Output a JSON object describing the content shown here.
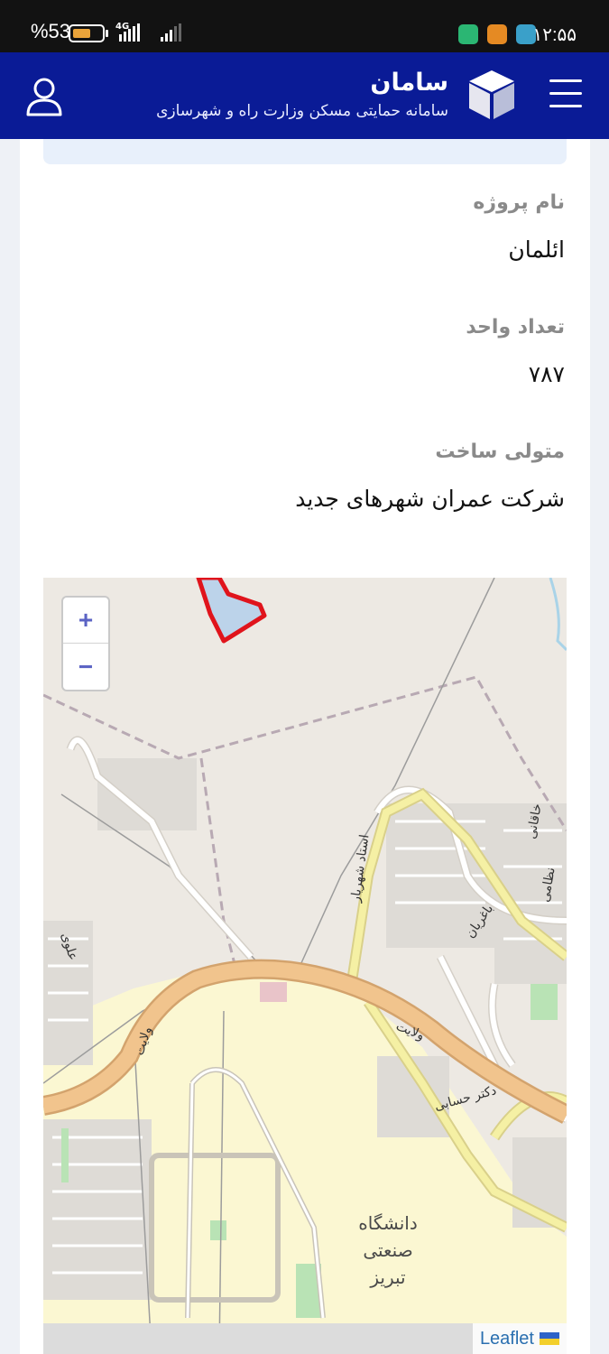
{
  "status_bar": {
    "battery_percent": "%53",
    "battery_level": 0.6,
    "network": "4G",
    "time": "۱۲:۵۵",
    "app_icons": [
      "shield-app",
      "orange-app",
      "photo-app"
    ]
  },
  "header": {
    "title": "سامان",
    "subtitle": "سامانه حمایتی مسکن وزارت راه و شهرسازی",
    "accent_color": "#0a1b96"
  },
  "details": [
    {
      "label": "نام پروژه",
      "value": "ائلمان"
    },
    {
      "label": "تعداد واحد",
      "value": "۷۸۷"
    },
    {
      "label": "متولی ساخت",
      "value": "شرکت عمران شهرهای جدید"
    }
  ],
  "map": {
    "zoom_in": "+",
    "zoom_out": "−",
    "attribution": "Leaflet",
    "street_labels": {
      "velayat_1": "ولایت",
      "velayat_2": "ولایت",
      "ostad_shahriar": "استاد شهریار",
      "baghrian": "باغریان",
      "alavi": "علوی",
      "dr_hesabi": "دکتر حسابی",
      "khaghani": "خاقانی",
      "nezami": "نظامی",
      "university_1": "دانشگاه",
      "university_2": "صنعتی",
      "university_3": "تبریز"
    },
    "colors": {
      "land": "#ede9e3",
      "campus": "#fbf7d2",
      "highway": "#f1c48d",
      "primary_road": "#f5f0a4",
      "project_boundary": "#e0141c"
    }
  }
}
